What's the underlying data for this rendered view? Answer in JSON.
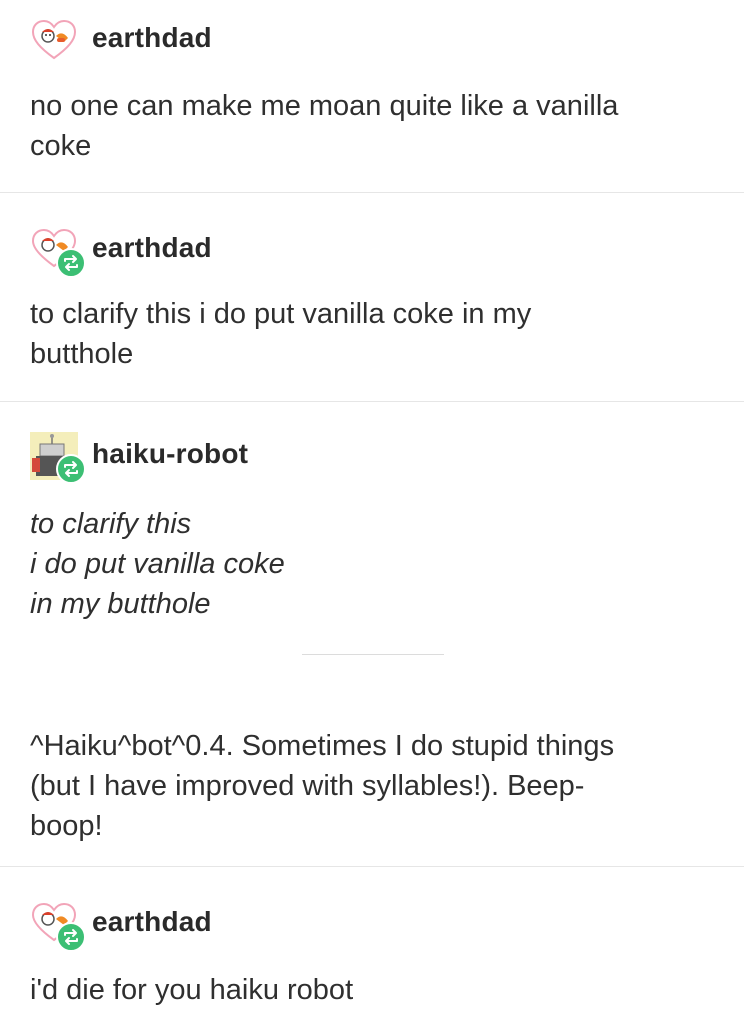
{
  "posts": [
    {
      "username": "earthdad",
      "avatar": "heart-avatar-icon",
      "reblog": false,
      "lines": [
        "no one can make me moan quite like a vanilla",
        "coke"
      ]
    },
    {
      "username": "earthdad",
      "avatar": "heart-avatar-icon",
      "reblog": true,
      "lines": [
        "to clarify this i do put vanilla coke in my",
        "butthole"
      ]
    },
    {
      "username": "haiku-robot",
      "avatar": "robot-avatar-icon",
      "reblog": true,
      "haiku": [
        "to clarify this",
        "i do put vanilla coke",
        "in my butthole"
      ],
      "footer": [
        "^Haiku^bot^0.4. Sometimes I do stupid things",
        "(but I have improved with syllables!). Beep-",
        "boop!"
      ]
    },
    {
      "username": "earthdad",
      "avatar": "heart-avatar-icon",
      "reblog": true,
      "lines": [
        "i'd die for you haiku robot"
      ]
    }
  ],
  "colors": {
    "reblog_badge": "#3cbf74",
    "heart_outline": "#f2a4b8",
    "divider": "#e6e6e6"
  }
}
